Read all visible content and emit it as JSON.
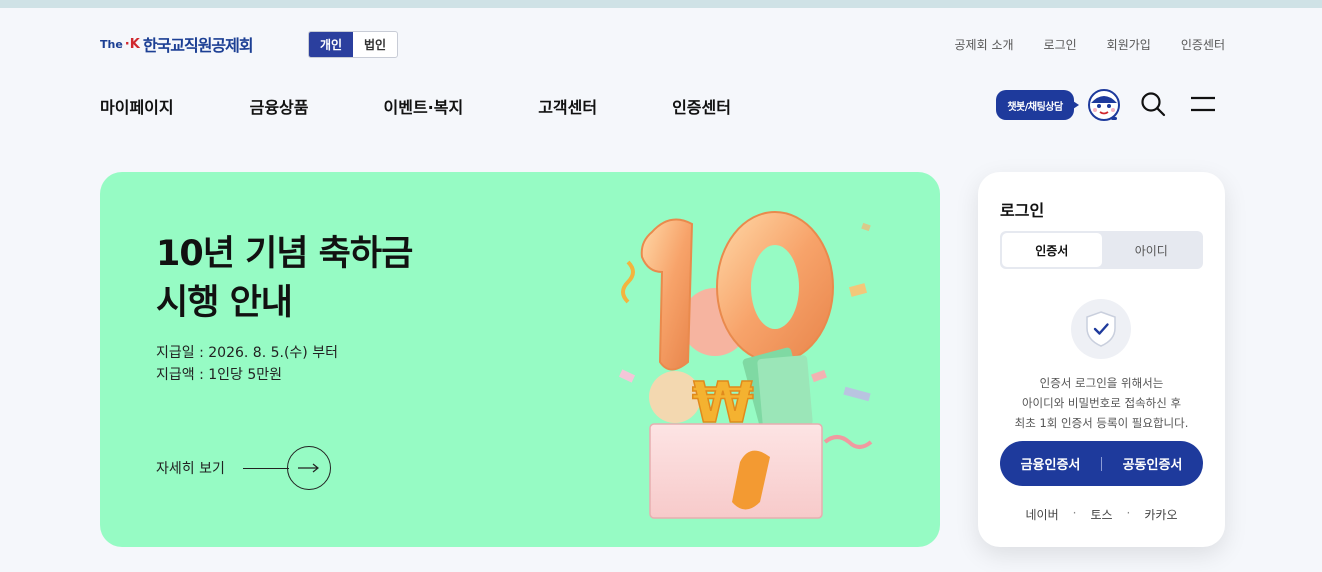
{
  "header": {
    "logo": {
      "the": "The",
      "k": "·K",
      "name": "한국교직원공제회"
    },
    "segment": [
      {
        "label": "개인",
        "active": true
      },
      {
        "label": "법인",
        "active": false
      }
    ],
    "util_links": [
      "공제회 소개",
      "로그인",
      "회원가입",
      "인증센터"
    ],
    "nav": [
      "마이페이지",
      "금융상품",
      "이벤트·복지",
      "고객센터",
      "인증센터"
    ],
    "chatbot_label": "챗봇/채팅상담",
    "icons": {
      "search": "search-icon",
      "menu": "hamburger-menu-icon",
      "mascot": "chatbot-mascot-icon"
    }
  },
  "banner": {
    "title_line1": "10년 기념 축하금",
    "title_line2": "시행 안내",
    "info_line1": "지급일 : 2026. 8. 5.(수) 부터",
    "info_line2": "지급액 : 1인당 5만원",
    "more_label": "자세히 보기",
    "background": "#96fbc4"
  },
  "login": {
    "title": "로그인",
    "tabs": [
      {
        "label": "인증서",
        "active": true
      },
      {
        "label": "아이디",
        "active": false
      }
    ],
    "desc_line1": "인증서 로그인을 위해서는",
    "desc_line2": "아이디와 비밀번호로 접속하신 후",
    "desc_line3": "최초 1회 인증서 등록이 필요합니다.",
    "cert_button_1": "금융인증서",
    "cert_button_2": "공동인증서",
    "social": [
      "네이버",
      "토스",
      "카카오"
    ],
    "accent": "#1e3a9c"
  }
}
